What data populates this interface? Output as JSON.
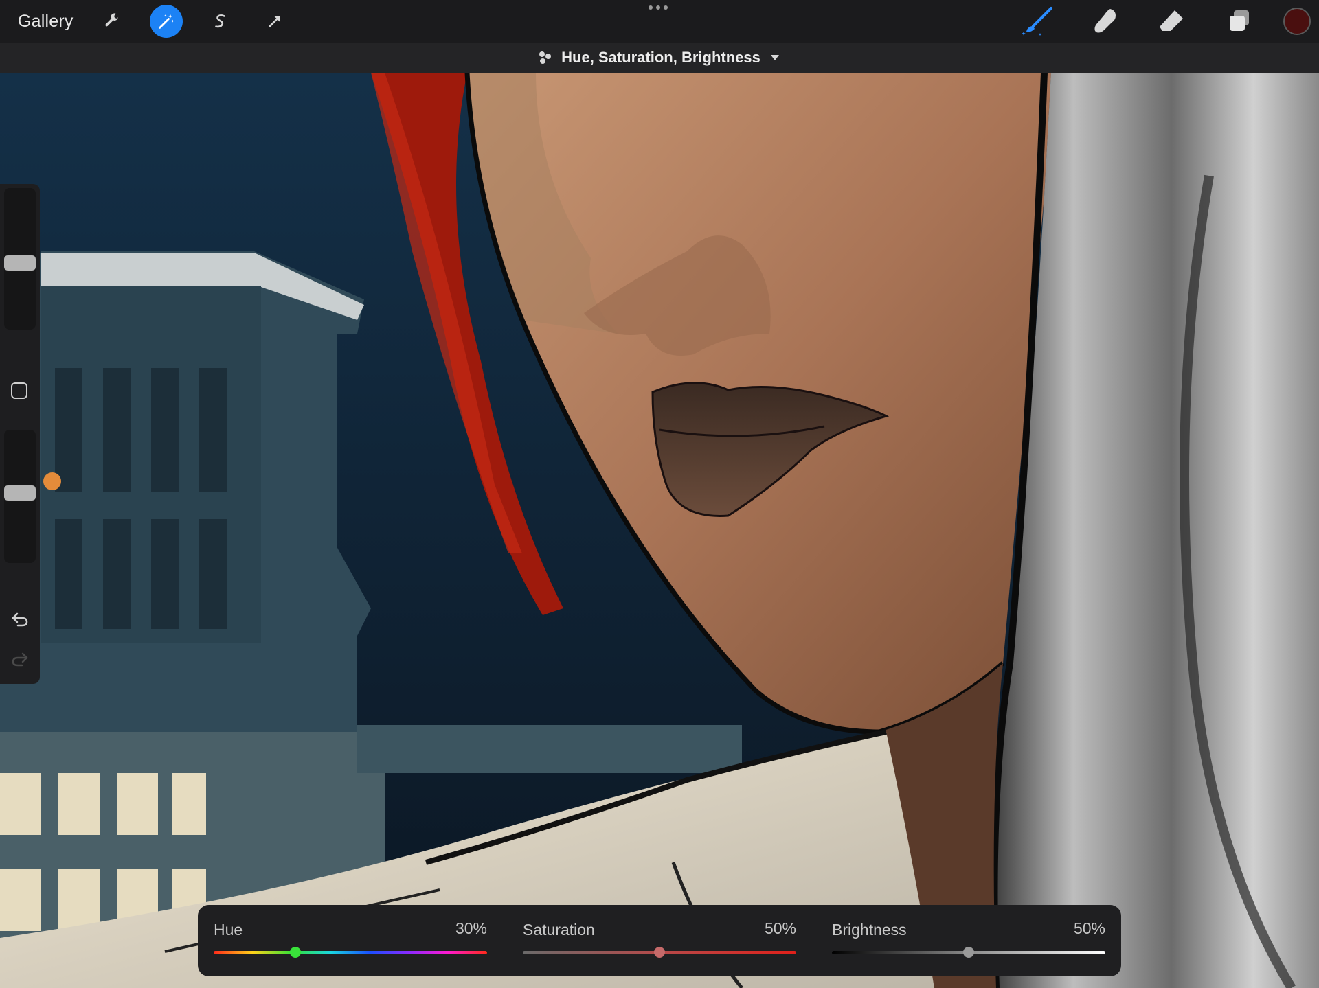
{
  "toolbar": {
    "gallery_label": "Gallery",
    "left_tools": [
      "wrench-icon",
      "magic-wand-icon",
      "selection-s-icon",
      "transform-arrow-icon"
    ],
    "active_tool": "magic-wand-icon",
    "right_tools": [
      "brush-icon",
      "smudge-icon",
      "eraser-icon",
      "layers-icon"
    ],
    "current_color": "#4a0f0f",
    "accent": "#1c82f5"
  },
  "adjustment": {
    "title": "Hue, Saturation, Brightness",
    "sliders": [
      {
        "label": "Hue",
        "value_text": "30%",
        "value": 0.3
      },
      {
        "label": "Saturation",
        "value_text": "50%",
        "value": 0.5
      },
      {
        "label": "Brightness",
        "value_text": "50%",
        "value": 0.5
      }
    ]
  },
  "sidebar": {
    "brush_size": 0.47,
    "opacity": 0.53
  }
}
